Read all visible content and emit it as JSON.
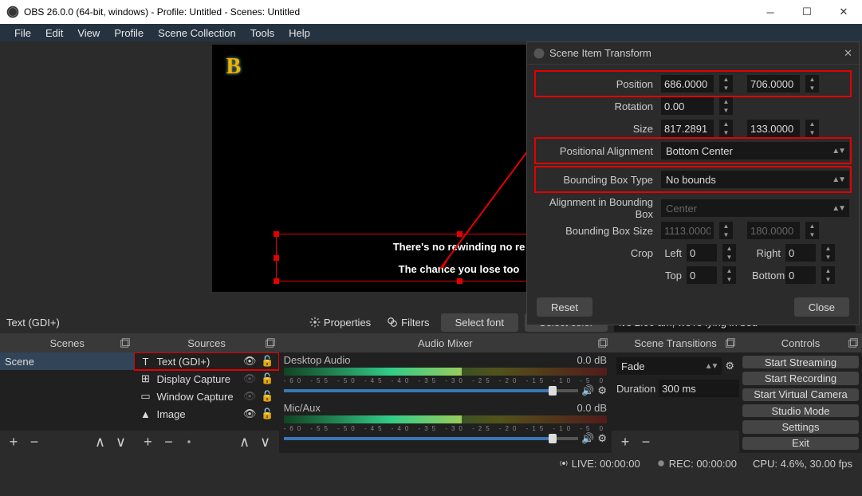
{
  "title": "OBS 26.0.0 (64-bit, windows) - Profile: Untitled - Scenes: Untitled",
  "menus": [
    "File",
    "Edit",
    "View",
    "Profile",
    "Scene Collection",
    "Tools",
    "Help"
  ],
  "subtitle_line1": "There's no rewinding no re",
  "subtitle_line2": "The chance you lose too",
  "dialog": {
    "title": "Scene Item Transform",
    "labels": {
      "position": "Position",
      "rotation": "Rotation",
      "size": "Size",
      "posalign": "Positional Alignment",
      "bbtype": "Bounding Box Type",
      "bbalign": "Alignment in Bounding Box",
      "bbsize": "Bounding Box Size",
      "crop": "Crop"
    },
    "posx": "686.0000",
    "posy": "706.0000",
    "rot": "0.00",
    "sizex": "817.2891",
    "sizey": "133.0000",
    "posalign": "Bottom Center",
    "bbtype": "No bounds",
    "bbalign": "Center",
    "bbw": "1113.0000",
    "bbh": "180.0000",
    "crop_left_l": "Left",
    "crop_left": "0",
    "crop_right_l": "Right",
    "crop_right": "0",
    "crop_top_l": "Top",
    "crop_top": "0",
    "crop_bottom_l": "Bottom",
    "crop_bottom": "0",
    "reset": "Reset",
    "close": "Close"
  },
  "srcbar": {
    "srcname": "Text (GDI+)",
    "properties": "Properties",
    "filters": "Filters",
    "selectfont": "Select font",
    "selectcolor": "Select color",
    "textinput": "It's 2:00 am, we're lying in bed"
  },
  "panels": {
    "scenes": "Scenes",
    "sources": "Sources",
    "audio": "Audio Mixer",
    "trans": "Scene Transitions",
    "controls": "Controls"
  },
  "scene_list": [
    "Scene"
  ],
  "source_list": [
    {
      "name": "Text (GDI+)",
      "icon": "T",
      "visible": true
    },
    {
      "name": "Display Capture",
      "icon": "⊞",
      "visible": false
    },
    {
      "name": "Window Capture",
      "icon": "▭",
      "visible": false
    },
    {
      "name": "Image",
      "icon": "▲",
      "visible": true
    }
  ],
  "audio": {
    "desktop": "Desktop Audio",
    "desktop_db": "0.0 dB",
    "mic": "Mic/Aux",
    "mic_db": "0.0 dB"
  },
  "transitions": {
    "value": "Fade",
    "duration_l": "Duration",
    "duration": "300 ms"
  },
  "controls": [
    "Start Streaming",
    "Start Recording",
    "Start Virtual Camera",
    "Studio Mode",
    "Settings",
    "Exit"
  ],
  "status": {
    "live": "LIVE: 00:00:00",
    "rec": "REC: 00:00:00",
    "cpu": "CPU: 4.6%, 30.00 fps"
  }
}
